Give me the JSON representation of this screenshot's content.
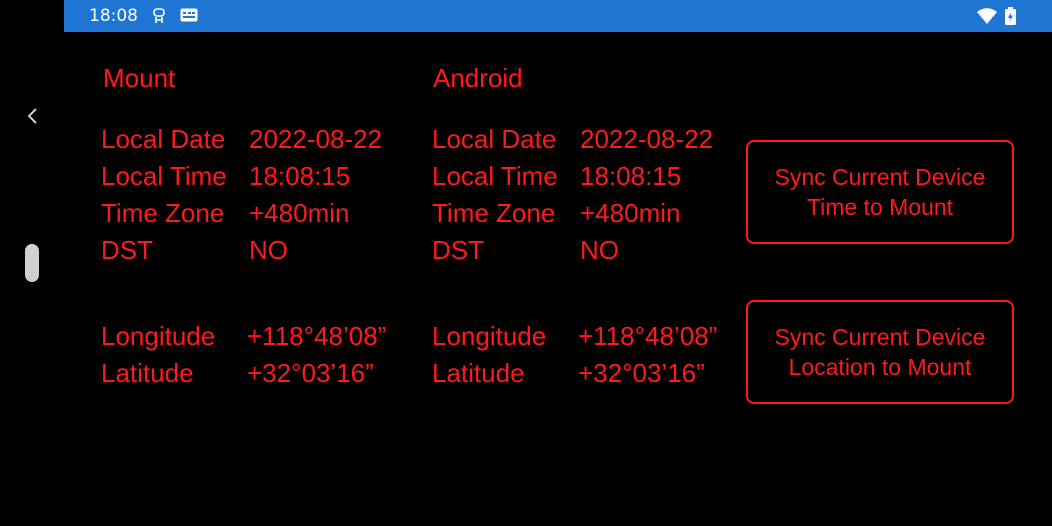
{
  "status_bar": {
    "time": "18:08",
    "color": "#1f76d2"
  },
  "icons": {
    "left": [
      "android-debug-icon",
      "keyboard-icon"
    ],
    "right": [
      "wifi-icon",
      "battery-icon"
    ],
    "nav": "chevron-left-icon"
  },
  "accent_color": "#ff1a1a",
  "mount": {
    "header": "Mount",
    "local_date_label": "Local Date",
    "local_date": "2022-08-22",
    "local_time_label": "Local Time",
    "local_time": "18:08:15",
    "time_zone_label": "Time Zone",
    "time_zone": "+480min",
    "dst_label": "DST",
    "dst": "NO",
    "longitude_label": "Longitude",
    "longitude": "+118°48’08”",
    "latitude_label": "Latitude",
    "latitude": "+32°03’16”"
  },
  "android": {
    "header": "Android",
    "local_date_label": "Local Date",
    "local_date": "2022-08-22",
    "local_time_label": "Local Time",
    "local_time": "18:08:15",
    "time_zone_label": "Time Zone",
    "time_zone": "+480min",
    "dst_label": "DST",
    "dst": "NO",
    "longitude_label": "Longitude",
    "longitude": "+118°48’08”",
    "latitude_label": "Latitude",
    "latitude": "+32°03’16”"
  },
  "buttons": {
    "sync_time_line1": "Sync Current Device",
    "sync_time_line2": "Time to Mount",
    "sync_location_line1": "Sync Current Device",
    "sync_location_line2": "Location to Mount"
  }
}
